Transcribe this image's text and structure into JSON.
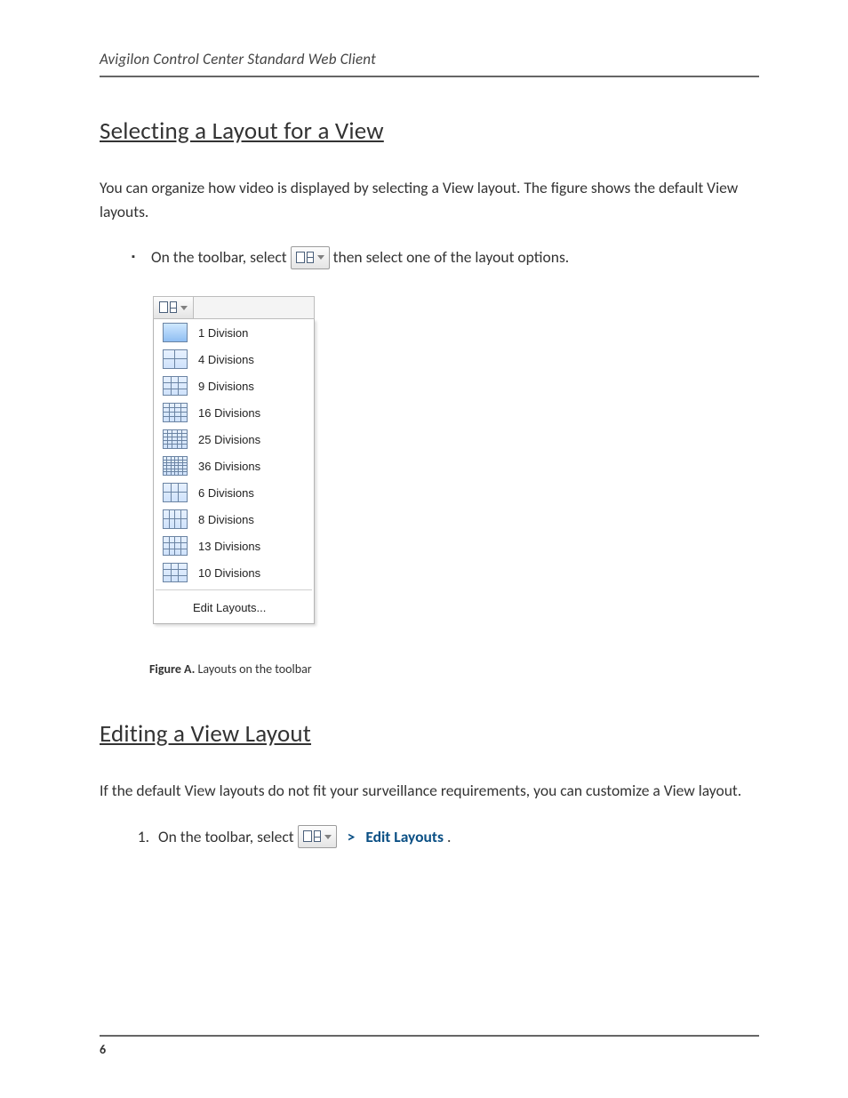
{
  "page": {
    "running_header": "Avigilon Control Center Standard Web Client",
    "page_number": "6"
  },
  "section1": {
    "heading": "Selecting a Layout for a View",
    "intro": "You can organize how video is displayed by selecting a View layout. The figure shows the default View layouts.",
    "bullet_pre": "On the toolbar, select",
    "bullet_post": "then select one of the layout options."
  },
  "menu": {
    "items": [
      {
        "label": "1 Division",
        "cols": 1,
        "rows": 1,
        "selected": true
      },
      {
        "label": "4 Divisions",
        "cols": 2,
        "rows": 2
      },
      {
        "label": "9 Divisions",
        "cols": 3,
        "rows": 3
      },
      {
        "label": "16 Divisions",
        "cols": 4,
        "rows": 4
      },
      {
        "label": "25 Divisions",
        "cols": 5,
        "rows": 5
      },
      {
        "label": "36 Divisions",
        "cols": 6,
        "rows": 6
      },
      {
        "label": "6 Divisions",
        "cols": 3,
        "rows": 2
      },
      {
        "label": "8 Divisions",
        "cols": 4,
        "rows": 2
      },
      {
        "label": "13 Divisions",
        "cols": 4,
        "rows": 3
      },
      {
        "label": "10 Divisions",
        "cols": 3,
        "rows": 3
      }
    ],
    "edit_label": "Edit Layouts..."
  },
  "figure": {
    "label_prefix": "Figure A.",
    "caption": "Layouts on the toolbar"
  },
  "section2": {
    "heading": "Editing a View Layout",
    "intro": "If the default View layouts do not fit your surveillance requirements, you can customize a View layout.",
    "step1_pre": "On the toolbar, select",
    "step1_sep": ">",
    "step1_link": "Edit Layouts",
    "step1_end": "."
  }
}
